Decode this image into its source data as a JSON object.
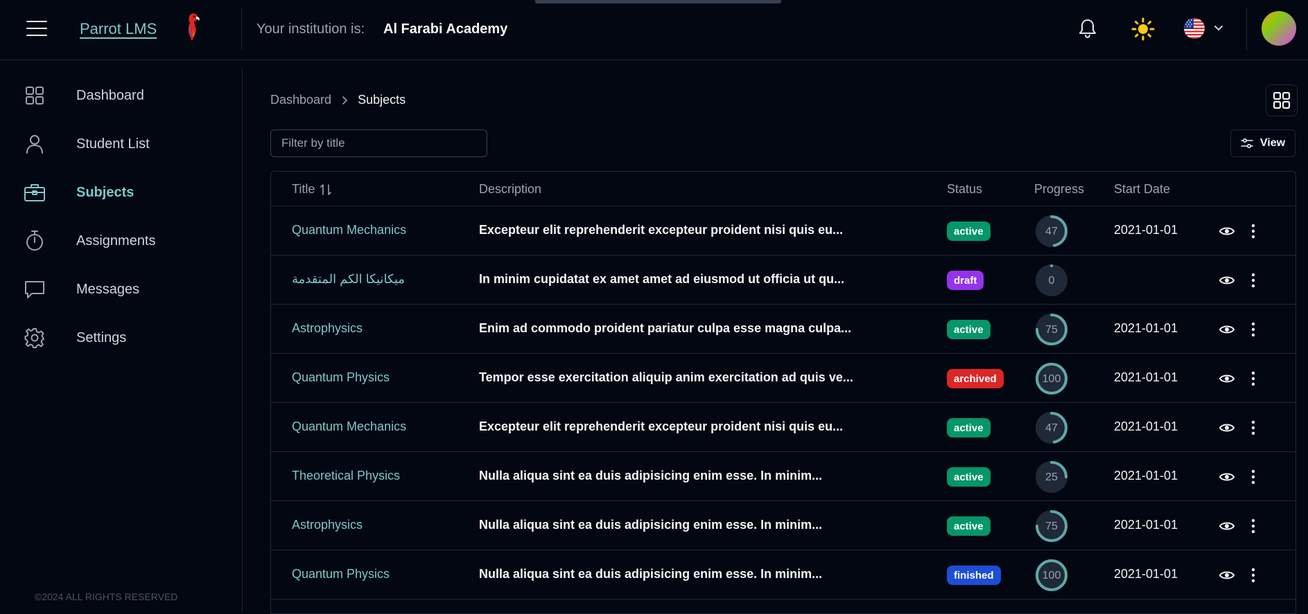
{
  "header": {
    "brand": "Parrot LMS",
    "institution_label": "Your institution is:",
    "institution_name": "Al Farabi Academy"
  },
  "sidebar": {
    "items": [
      {
        "label": "Dashboard",
        "icon": "grid-icon",
        "active": false
      },
      {
        "label": "Student List",
        "icon": "user-icon",
        "active": false
      },
      {
        "label": "Subjects",
        "icon": "briefcase-icon",
        "active": true
      },
      {
        "label": "Assignments",
        "icon": "stopwatch-icon",
        "active": false
      },
      {
        "label": "Messages",
        "icon": "chat-icon",
        "active": false
      },
      {
        "label": "Settings",
        "icon": "gear-icon",
        "active": false
      }
    ],
    "footer": "©2024 ALL RIGHTS RESERVED"
  },
  "breadcrumb": {
    "root": "Dashboard",
    "current": "Subjects"
  },
  "filter": {
    "placeholder": "Filter by title"
  },
  "view_button": "View",
  "table": {
    "columns": [
      "Title",
      "Description",
      "Status",
      "Progress",
      "Start Date"
    ],
    "rows": [
      {
        "title": "Quantum Mechanics",
        "description": "Excepteur elit reprehenderit excepteur proident nisi quis eu...",
        "status": "active",
        "progress": 47,
        "start_date": "2021-01-01"
      },
      {
        "title": "ميكانيكا الكم المتقدمة",
        "description": "In minim cupidatat ex amet amet ad eiusmod ut officia ut qu...",
        "status": "draft",
        "progress": 0,
        "start_date": ""
      },
      {
        "title": "Astrophysics",
        "description": "Enim ad commodo proident pariatur culpa esse magna culpa...",
        "status": "active",
        "progress": 75,
        "start_date": "2021-01-01"
      },
      {
        "title": "Quantum Physics",
        "description": "Tempor esse exercitation aliquip anim exercitation ad quis ve...",
        "status": "archived",
        "progress": 100,
        "start_date": "2021-01-01"
      },
      {
        "title": "Quantum Mechanics",
        "description": "Excepteur elit reprehenderit excepteur proident nisi quis eu...",
        "status": "active",
        "progress": 47,
        "start_date": "2021-01-01"
      },
      {
        "title": "Theoretical Physics",
        "description": "Nulla aliqua sint ea duis adipisicing enim esse. In minim...",
        "status": "active",
        "progress": 25,
        "start_date": "2021-01-01"
      },
      {
        "title": "Astrophysics",
        "description": "Nulla aliqua sint ea duis adipisicing enim esse. In minim...",
        "status": "active",
        "progress": 75,
        "start_date": "2021-01-01"
      },
      {
        "title": "Quantum Physics",
        "description": "Nulla aliqua sint ea duis adipisicing enim esse. In minim...",
        "status": "finished",
        "progress": 100,
        "start_date": "2021-01-01"
      }
    ]
  },
  "colors": {
    "accent": "#7ec8c8",
    "background": "#030712",
    "status_active": "#059669",
    "status_draft": "#9333ea",
    "status_archived": "#dc2626",
    "status_finished": "#1d4ed8",
    "progress_track": "#1f2937",
    "progress_fill": "#5fa8a8"
  }
}
